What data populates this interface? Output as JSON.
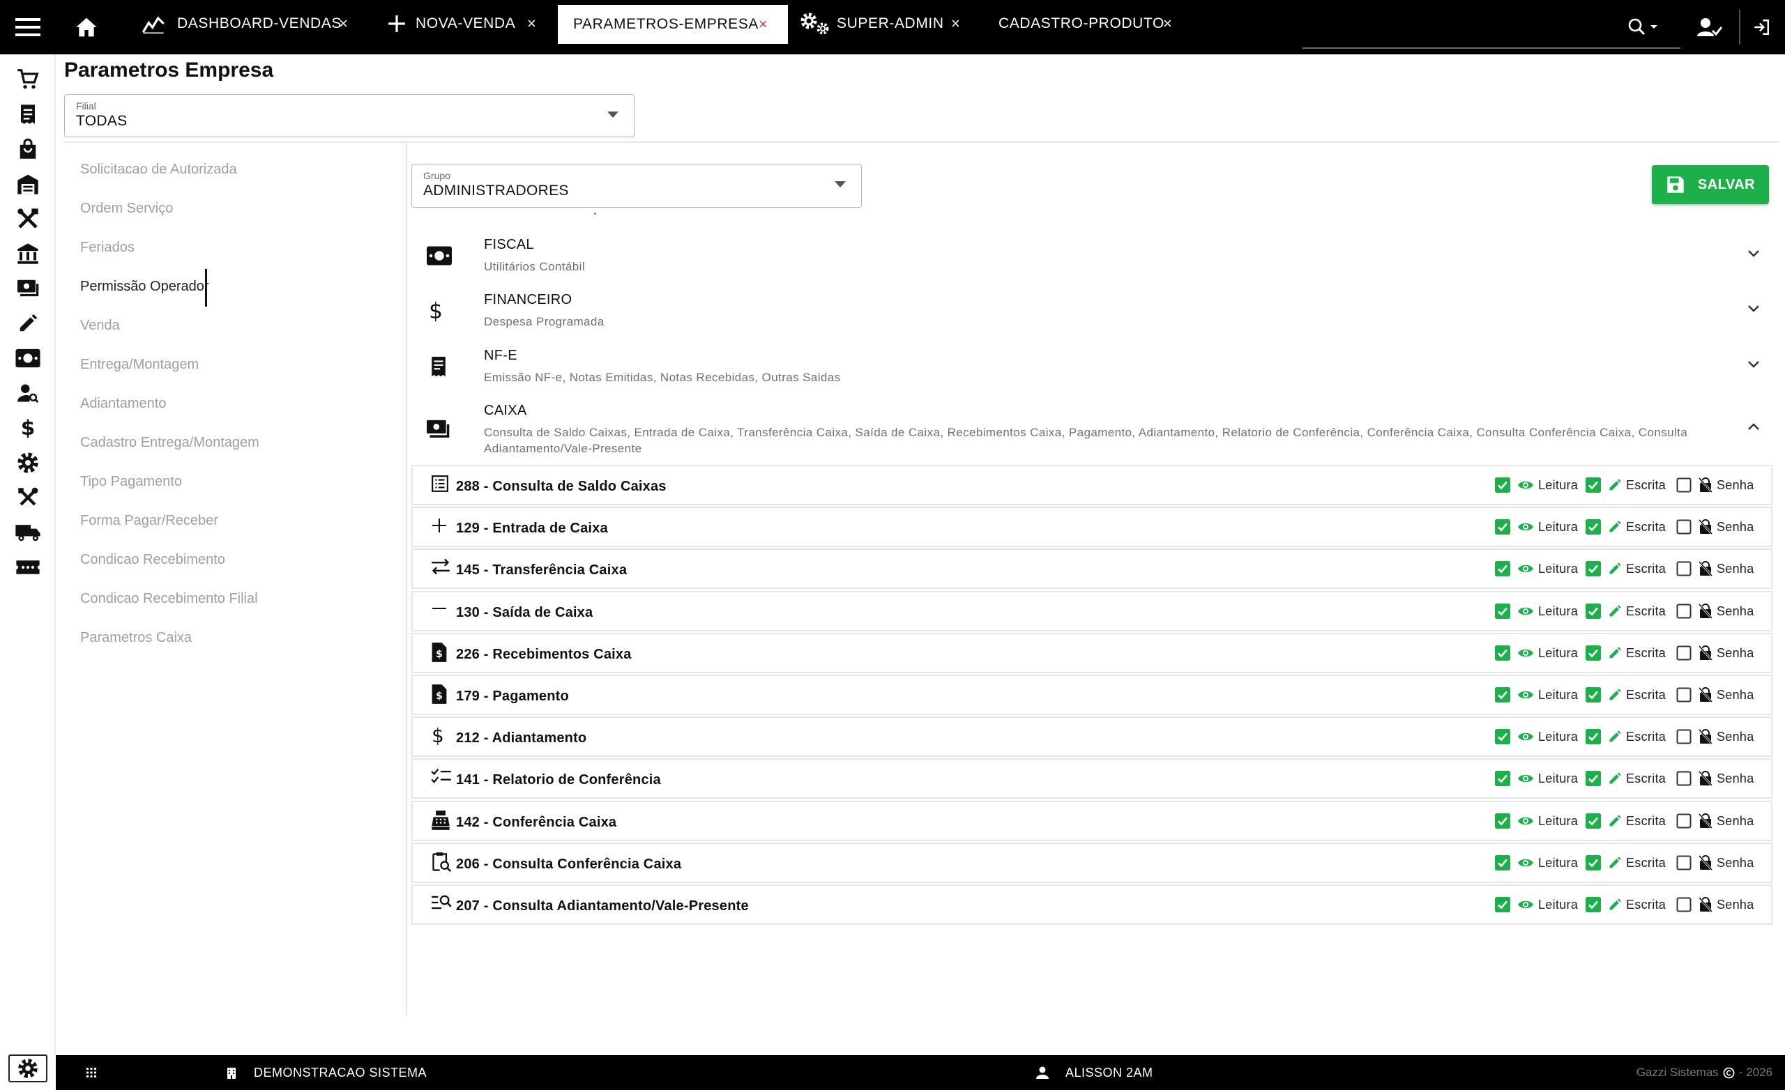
{
  "topbar": {
    "menu_icon": "hamburger-menu-icon",
    "home_icon": "home-icon",
    "tabs": [
      {
        "label": "DASHBOARD-VENDAS",
        "icon": "chart-line-icon",
        "close": "×"
      },
      {
        "label": "NOVA-VENDA",
        "icon": "plus-icon",
        "close": "×"
      },
      {
        "label": "PARAMETROS-EMPRESA",
        "icon": "",
        "close": "×",
        "active": true
      },
      {
        "label": "SUPER-ADMIN",
        "icon": "gears-icon",
        "close": "×"
      },
      {
        "label": "CADASTRO-PRODUTO",
        "icon": "",
        "close": "×"
      }
    ],
    "search_icon": "search-icon",
    "user_icon": "user-check-icon",
    "logout_icon": "logout-icon"
  },
  "rail": {
    "icons": [
      "cart-icon",
      "receipt-icon",
      "shopping-bag-icon",
      "warehouse-icon",
      "tools-icon",
      "bank-icon",
      "payments-icon",
      "pencil-icon",
      "cash-icon",
      "person-search-icon",
      "dollar-icon",
      "settings-icon",
      "build-icon",
      "truck-icon",
      "ticket-icon"
    ],
    "bottom_settings_icon": "settings-icon"
  },
  "page": {
    "title": "Parametros Empresa",
    "filial": {
      "label": "Filial",
      "value": "TODAS"
    }
  },
  "menu": {
    "items": [
      "Solicitacao de Autorizada",
      "Ordem Serviço",
      "Feriados",
      "Permissão Operador",
      "Venda",
      "Entrega/Montagem",
      "Adiantamento",
      "Cadastro Entrega/Montagem",
      "Tipo Pagamento",
      "Forma Pagar/Receber",
      "Condicao Recebimento",
      "Condicao Recebimento Filial",
      "Parametros Caixa"
    ],
    "active_index": 3
  },
  "main": {
    "grupo": {
      "label": "Grupo",
      "value": "ADMINISTRADORES"
    },
    "save_label": "SALVAR",
    "sections": [
      {
        "title": "FISCAL",
        "subtitle": "Utilitários Contábil",
        "icon": "money-icon",
        "expanded": false
      },
      {
        "title": "FINANCEIRO",
        "subtitle": "Despesa Programada",
        "icon": "dollar-icon",
        "expanded": false
      },
      {
        "title": "NF-E",
        "subtitle": "Emissão NF-e, Notas Emitidas, Notas Recebidas, Outras Saidas",
        "icon": "receipt-icon",
        "expanded": false
      },
      {
        "title": "CAIXA",
        "subtitle": "Consulta de Saldo Caixas, Entrada de Caixa, Transferência Caixa, Saída de Caixa, Recebimentos Caixa, Pagamento, Adiantamento, Relatorio de Conferência, Conferência Caixa, Consulta Conferência Caixa, Consulta Adiantamento/Vale-Presente",
        "icon": "payments-icon",
        "expanded": true
      }
    ],
    "permission_labels": {
      "read": "Leitura",
      "write": "Escrita",
      "password": "Senha"
    },
    "permissions": [
      {
        "label": "288 - Consulta de Saldo Caixas",
        "icon": "list-alt-icon",
        "read": true,
        "write": true,
        "password": false
      },
      {
        "label": "129 - Entrada de Caixa",
        "icon": "plus-icon",
        "read": true,
        "write": true,
        "password": false
      },
      {
        "label": "145 - Transferência Caixa",
        "icon": "swap-icon",
        "read": true,
        "write": true,
        "password": false
      },
      {
        "label": "130 - Saída de Caixa",
        "icon": "minus-icon",
        "read": true,
        "write": true,
        "password": false
      },
      {
        "label": "226 - Recebimentos Caixa",
        "icon": "request-quote-icon",
        "read": true,
        "write": true,
        "password": false
      },
      {
        "label": "179 - Pagamento",
        "icon": "request-quote-icon",
        "read": true,
        "write": true,
        "password": false
      },
      {
        "label": "212 - Adiantamento",
        "icon": "dollar-icon",
        "read": true,
        "write": true,
        "password": false
      },
      {
        "label": "141 - Relatorio de Conferência",
        "icon": "checklist-icon",
        "read": true,
        "write": true,
        "password": false
      },
      {
        "label": "142 - Conferência Caixa",
        "icon": "cash-register-icon",
        "read": true,
        "write": true,
        "password": false
      },
      {
        "label": "206 - Consulta Conferência Caixa",
        "icon": "content-paste-search-icon",
        "read": true,
        "write": true,
        "password": false
      },
      {
        "label": "207 - Consulta Adiantamento/Vale-Presente",
        "icon": "manage-search-icon",
        "read": true,
        "write": true,
        "password": false
      }
    ]
  },
  "bottombar": {
    "apps_icon": "apps-grid-icon",
    "company_icon": "building-icon",
    "company": "DEMONSTRACAO SISTEMA",
    "user_icon": "person-icon",
    "user": "ALISSON 2AM",
    "copyright_prefix": "Gazzi Sistemas",
    "copyright_icon": "copyright-icon",
    "copyright_year": "- 2026"
  },
  "colors": {
    "accent": "#1db04a",
    "topbar": "#000000",
    "active_tab_close": "#e53935",
    "muted_text": "#9e9e9e"
  }
}
